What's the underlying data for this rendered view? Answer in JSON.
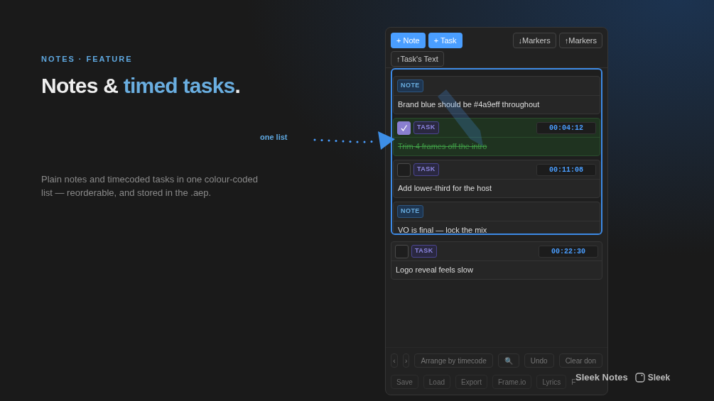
{
  "eyebrow": "NOTES · FEATURE",
  "headline": "Notes & ",
  "headline_accent": "timed tasks",
  "headline_end": ".",
  "description": "Plain notes and timecoded tasks in one colour-coded list — reorderable, and stored in the .aep.",
  "callout": "one list",
  "panel": {
    "toolbar_left": [
      "+ Note",
      "+ Task"
    ],
    "toolbar_right": [
      "↓Markers",
      "↑Markers"
    ],
    "toolbar_second": [
      "↑Task's Text"
    ],
    "group_items": [
      {
        "kind": "note",
        "tag": "NOTE",
        "text": "Brand blue should be #4a9eff throughout"
      },
      {
        "kind": "task",
        "tag": "TASK",
        "checked": true,
        "timecode": "00:04:12",
        "text": "Trim 4 frames off the intro"
      },
      {
        "kind": "task",
        "tag": "TASK",
        "checked": false,
        "timecode": "00:11:08",
        "text": "Add lower-third for the host"
      },
      {
        "kind": "note",
        "tag": "NOTE",
        "text": "VO is final — lock the mix"
      }
    ],
    "items": [
      {
        "kind": "task",
        "tag": "TASK",
        "checked": false,
        "timecode": "00:22:30",
        "text": "Logo reveal feels slow"
      }
    ],
    "bottom_row": [
      "‹",
      "›",
      "Arrange by timecode",
      "🔍",
      "Undo",
      "Clear don"
    ],
    "bottom_row_faded": [
      "Save",
      "Load",
      "Export",
      "Frame.io",
      "Lyrics"
    ],
    "faded_letter": "F"
  },
  "brand": {
    "product": "Sleek Notes",
    "logo_text": "Sleek"
  }
}
